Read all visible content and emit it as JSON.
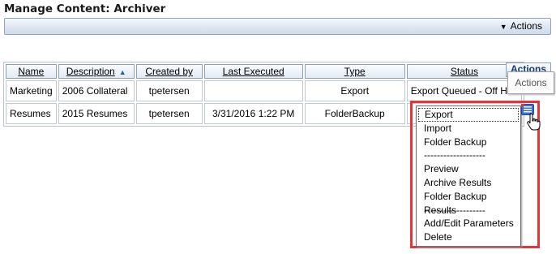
{
  "page": {
    "title": "Manage Content: Archiver"
  },
  "toolbar": {
    "actions_label": "Actions"
  },
  "table": {
    "columns": {
      "name": "Name",
      "description": "Description",
      "created_by": "Created by",
      "last_executed": "Last Executed",
      "type": "Type",
      "status": "Status",
      "actions": "Actions"
    },
    "rows": [
      {
        "name": "Marketing",
        "description": "2006 Collateral",
        "created_by": "tpetersen",
        "last_executed": "",
        "type": "Export",
        "status": "Export Queued - Off Hou"
      },
      {
        "name": "Resumes",
        "description": "2015 Resumes",
        "created_by": "tpetersen",
        "last_executed": "3/31/2016 1:22 PM",
        "type": "FolderBackup",
        "status": ""
      }
    ]
  },
  "tooltip": {
    "text": "Actions"
  },
  "context_menu": {
    "items": [
      "Export",
      "Import",
      "Folder Backup",
      "-------------------",
      "Preview",
      "Archive Results",
      "Folder Backup Results",
      "-------------------",
      "Add/Edit Parameters",
      "Delete"
    ]
  },
  "colors": {
    "highlight": "#e0383a",
    "header_border": "#8ca0bd",
    "icon_blue": "#2a5caa"
  },
  "icons": {
    "actions_row": "actions-menu-icon",
    "cursor": "hand-pointer-icon",
    "sort": "sort-ascending-icon"
  }
}
